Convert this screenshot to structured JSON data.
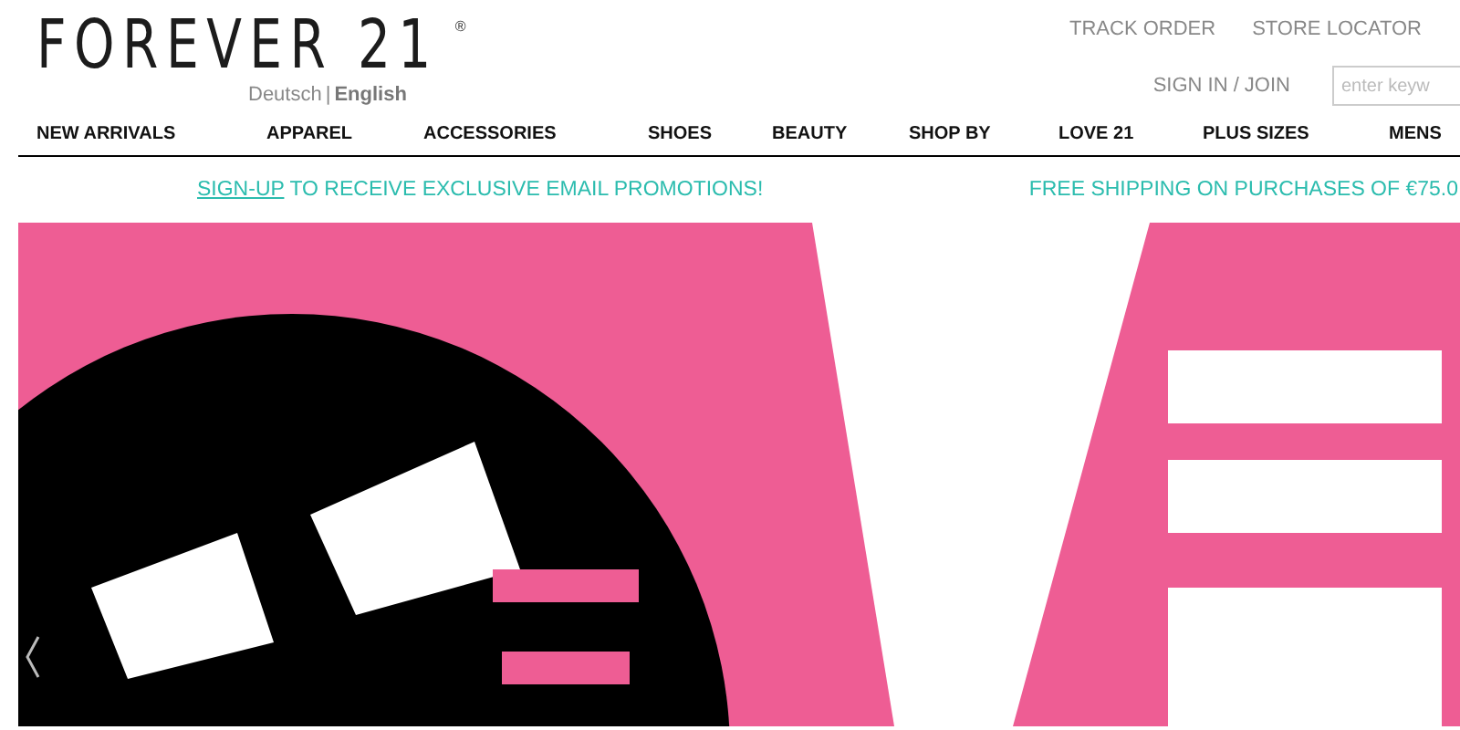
{
  "logo": {
    "name": "FOREVER 21",
    "mark": "®"
  },
  "languages": [
    {
      "label": "Deutsch",
      "selected": false
    },
    {
      "label": "English",
      "selected": true
    }
  ],
  "language_separator": "|",
  "top_links": [
    "TRACK ORDER",
    "STORE LOCATOR"
  ],
  "account_link": "SIGN IN / JOIN",
  "search": {
    "placeholder": "enter keyw"
  },
  "nav": [
    "NEW ARRIVALS",
    "APPAREL",
    "ACCESSORIES",
    "SHOES",
    "BEAUTY",
    "SHOP BY",
    "LOVE 21",
    "PLUS SIZES",
    "MENS"
  ],
  "promo": {
    "link": "SIGN-UP",
    "text": "TO RECEIVE EXCLUSIVE EMAIL PROMOTIONS!",
    "shipping": "FREE SHIPPING ON PURCHASES OF €75.0"
  }
}
